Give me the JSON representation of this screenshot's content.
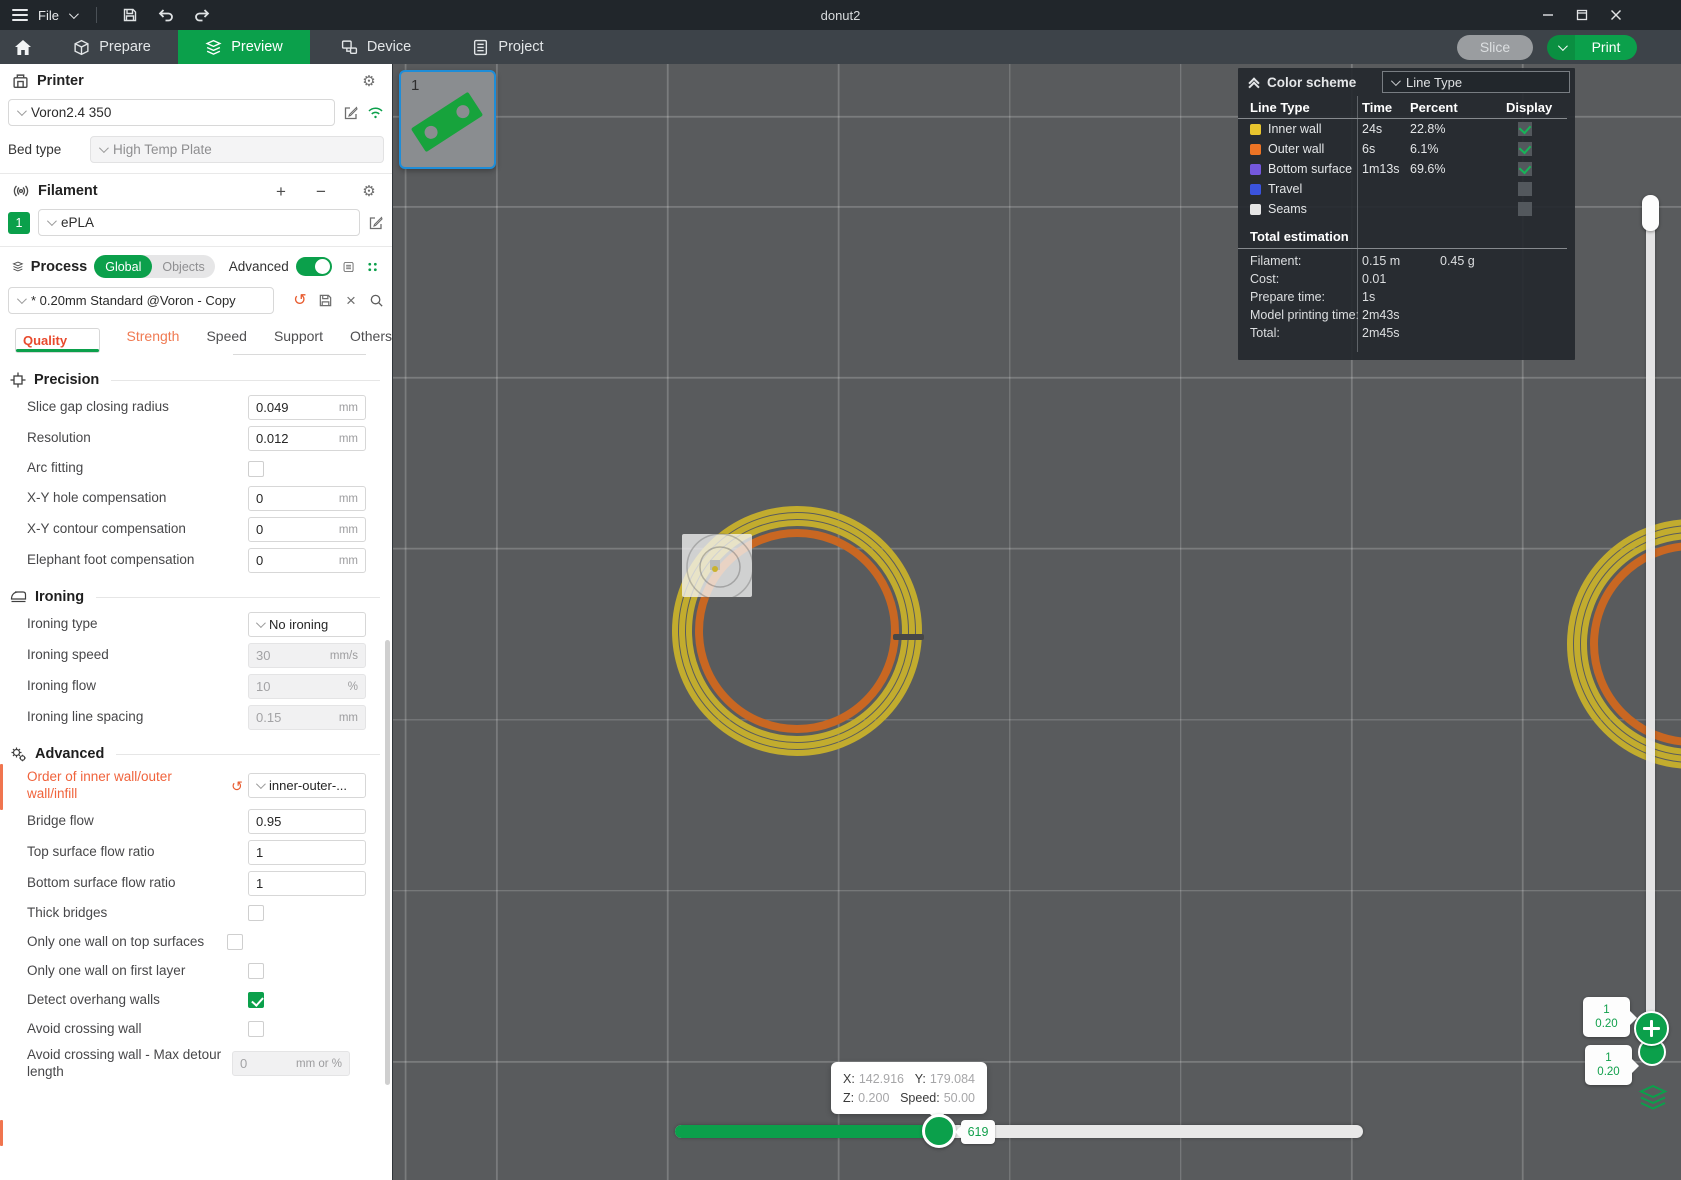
{
  "colors": {
    "accent_green": "#0BA04B",
    "modified_orange": "#F0633C",
    "inner_wall": "#E8C52E",
    "outer_wall": "#ED7425",
    "bottom_surface": "#7458DE",
    "travel": "#3B53DE",
    "seams": "#E6E6E6",
    "inner_wall_render": "#C2AC2E",
    "outer_wall_render": "#C96722"
  },
  "icons": {
    "gear": "⚙",
    "reset": "↺",
    "close": "×",
    "plus": "+",
    "minus": "−"
  },
  "titlebar": {
    "file": "File",
    "title": "donut2"
  },
  "nav": {
    "prepare": "Prepare",
    "preview": "Preview",
    "device": "Device",
    "project": "Project",
    "slice": "Slice",
    "print": "Print"
  },
  "printer": {
    "title": "Printer",
    "name": "Voron2.4 350",
    "bed_label": "Bed type",
    "bed_value": "High Temp Plate"
  },
  "filament": {
    "title": "Filament",
    "slot": "1",
    "name": "ePLA"
  },
  "process": {
    "title": "Process",
    "seg_global": "Global",
    "seg_objects": "Objects",
    "advanced_label": "Advanced",
    "preset": "* 0.20mm Standard @Voron - Copy",
    "tabs": {
      "quality": "Quality",
      "strength": "Strength",
      "speed": "Speed",
      "support": "Support",
      "others": "Others"
    }
  },
  "settings": {
    "precision": {
      "title": "Precision",
      "slice_gap": {
        "label": "Slice gap closing radius",
        "value": "0.049",
        "unit": "mm"
      },
      "resolution": {
        "label": "Resolution",
        "value": "0.012",
        "unit": "mm"
      },
      "arc_fitting": {
        "label": "Arc fitting"
      },
      "xy_hole": {
        "label": "X-Y hole compensation",
        "value": "0",
        "unit": "mm"
      },
      "xy_contour": {
        "label": "X-Y contour compensation",
        "value": "0",
        "unit": "mm"
      },
      "elephant_foot": {
        "label": "Elephant foot compensation",
        "value": "0",
        "unit": "mm"
      }
    },
    "ironing": {
      "title": "Ironing",
      "type": {
        "label": "Ironing type",
        "value": "No ironing"
      },
      "speed": {
        "label": "Ironing speed",
        "value": "30",
        "unit": "mm/s"
      },
      "flow": {
        "label": "Ironing flow",
        "value": "10",
        "unit": "%"
      },
      "spacing": {
        "label": "Ironing line spacing",
        "value": "0.15",
        "unit": "mm"
      }
    },
    "advanced": {
      "title": "Advanced",
      "wall_order": {
        "label": "Order of inner wall/outer wall/infill",
        "value": "inner-outer-..."
      },
      "bridge_flow": {
        "label": "Bridge flow",
        "value": "0.95"
      },
      "top_flow": {
        "label": "Top surface flow ratio",
        "value": "1"
      },
      "bottom_flow": {
        "label": "Bottom surface flow ratio",
        "value": "1"
      },
      "thick_bridges": {
        "label": "Thick bridges"
      },
      "one_wall_top": {
        "label": "Only one wall on top surfaces"
      },
      "one_wall_first": {
        "label": "Only one wall on first layer"
      },
      "detect_overhang": {
        "label": "Detect overhang walls"
      },
      "avoid_crossing": {
        "label": "Avoid crossing wall"
      },
      "avoid_detour": {
        "label": "Avoid crossing wall - Max detour length",
        "value": "0",
        "unit": "mm or %"
      }
    }
  },
  "legend": {
    "title": "Color scheme",
    "scheme": "Line Type",
    "col_line_type": "Line Type",
    "col_time": "Time",
    "col_percent": "Percent",
    "col_display": "Display",
    "rows": [
      {
        "name": "Inner wall",
        "time": "24s",
        "percent": "22.8%"
      },
      {
        "name": "Outer wall",
        "time": "6s",
        "percent": "6.1%"
      },
      {
        "name": "Bottom surface",
        "time": "1m13s",
        "percent": "69.6%"
      },
      {
        "name": "Travel",
        "time": "",
        "percent": ""
      },
      {
        "name": "Seams",
        "time": "",
        "percent": ""
      }
    ],
    "totals": {
      "title": "Total estimation",
      "filament_label": "Filament:",
      "filament_len": "0.15 m",
      "filament_weight": "0.45 g",
      "cost_label": "Cost:",
      "cost": "0.01",
      "prepare_label": "Prepare time:",
      "prepare": "1s",
      "model_label": "Model printing time:",
      "model": "2m43s",
      "total_label": "Total:",
      "total": "2m45s"
    }
  },
  "viewport": {
    "plate_number": "1",
    "tooltip": {
      "x_label": "X:",
      "x": "142.916",
      "y_label": "Y:",
      "y": "179.084",
      "z_label": "Z:",
      "z": "0.200",
      "speed_label": "Speed:",
      "speed": "50.00"
    },
    "layer_slider": {
      "value": "619"
    },
    "layer_badge_top": {
      "line1": "1",
      "line2": "0.20"
    },
    "layer_badge_bottom": {
      "line1": "1",
      "line2": "0.20"
    }
  }
}
